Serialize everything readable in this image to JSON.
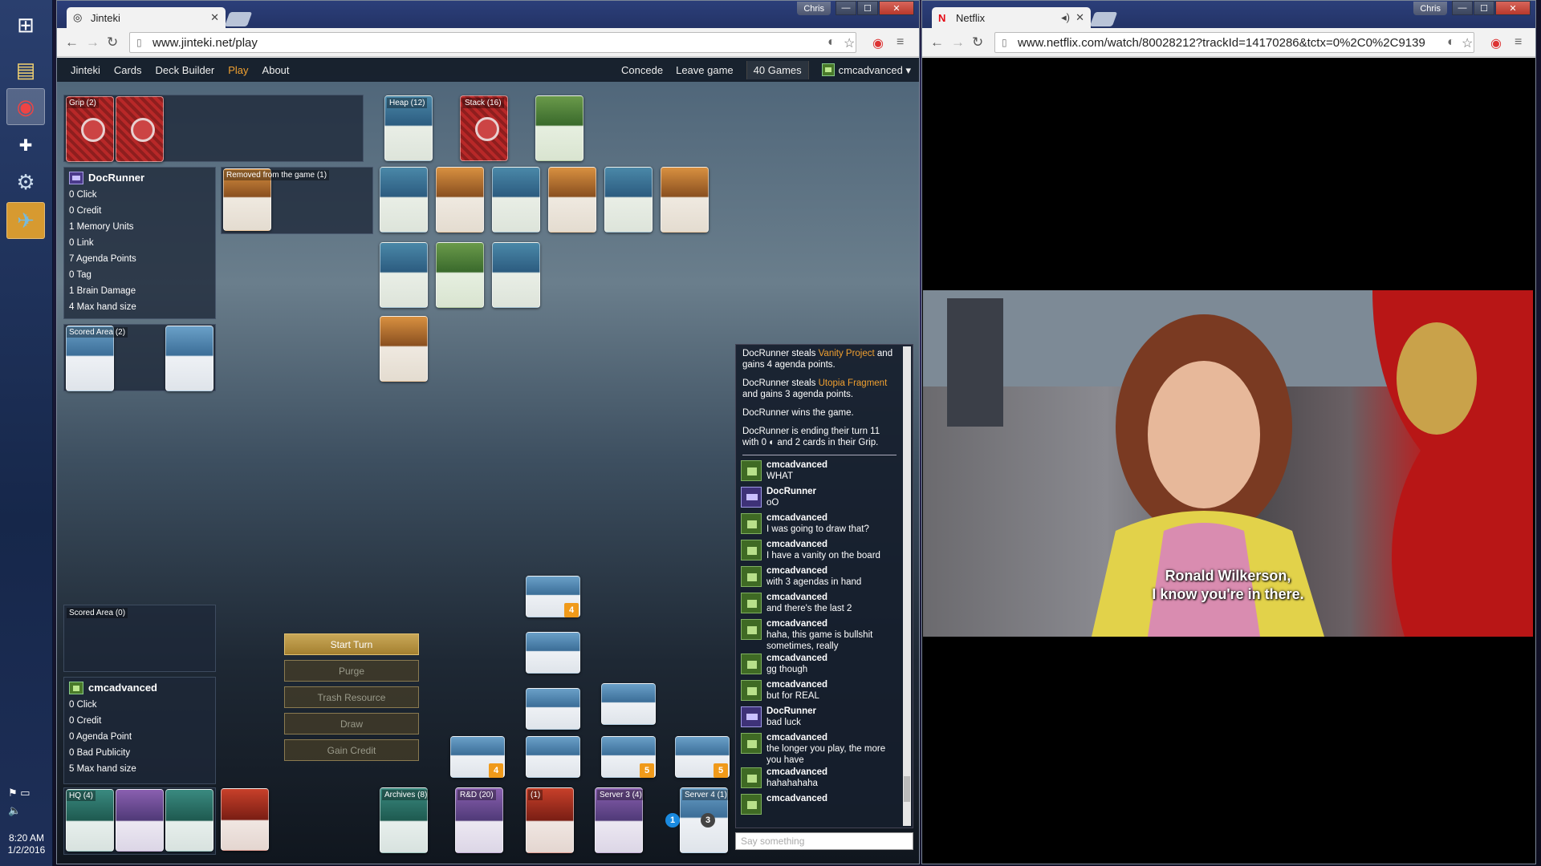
{
  "taskbar": {
    "clock_time": "8:20 AM",
    "clock_date": "1/2/2016"
  },
  "jinteki_window": {
    "profile": "Chris",
    "tab_title": "Jinteki",
    "url": "www.jinteki.net/play",
    "nav": {
      "items": [
        "Jinteki",
        "Cards",
        "Deck Builder",
        "Play",
        "About"
      ],
      "active": "Play",
      "concede": "Concede",
      "leave": "Leave game",
      "games": "40 Games",
      "user": "cmcadvanced"
    }
  },
  "netflix_window": {
    "profile": "Chris",
    "tab_title": "Netflix",
    "url": "www.netflix.com/watch/80028212?trackId=14170286&tctx=0%2C0%2C9139",
    "subtitle_line1": "Ronald Wilkerson,",
    "subtitle_line2": "I know you're in there."
  },
  "runner_board": {
    "grip_label": "Grip (2)",
    "heap_label": "Heap (12)",
    "stack_label": "Stack (16)",
    "removed_label": "Removed from the game (1)",
    "scored_label": "Scored Area (2)",
    "player": {
      "name": "DocRunner",
      "stats": [
        "0 Click",
        "0 Credit",
        "1 Memory Units",
        "0 Link",
        "7 Agenda Points",
        "0 Tag",
        "1 Brain Damage",
        "4 Max hand size"
      ]
    }
  },
  "corp_board": {
    "scored_label": "Scored Area (0)",
    "hq_label": "HQ (4)",
    "archives_label": "Archives (8)",
    "rd_label": "R&D (20)",
    "server_label": "(1)",
    "server3_label": "Server 3 (4)",
    "server4_label": "Server 4 (1)",
    "counters": [
      "4",
      "4",
      "5",
      "5",
      "1",
      "3"
    ],
    "player": {
      "name": "cmcadvanced",
      "stats": [
        "0 Click",
        "0 Credit",
        "0 Agenda Point",
        "0 Bad Publicity",
        "5 Max hand size"
      ]
    },
    "actions": {
      "start_turn": "Start Turn",
      "purge": "Purge",
      "trash_resource": "Trash Resource",
      "draw": "Draw",
      "gain_credit": "Gain Credit"
    }
  },
  "log": {
    "system": [
      {
        "pre": "DocRunner steals ",
        "card": "Vanity Project",
        "post": " and gains 4 agenda points."
      },
      {
        "pre": "DocRunner steals ",
        "card": "Utopia Fragment",
        "post": " and gains 3 agenda points."
      },
      {
        "pre": "DocRunner wins the game.",
        "card": "",
        "post": ""
      },
      {
        "pre": "DocRunner is ending their turn 11 with 0 ◐ and 2 cards in their Grip.",
        "card": "",
        "post": ""
      }
    ],
    "chat": [
      {
        "user": "cmcadvanced",
        "side": "corp",
        "text": "WHAT"
      },
      {
        "user": "DocRunner",
        "side": "runner",
        "text": "oO"
      },
      {
        "user": "cmcadvanced",
        "side": "corp",
        "text": "I was going to draw that?"
      },
      {
        "user": "cmcadvanced",
        "side": "corp",
        "text": "I have a vanity on the board"
      },
      {
        "user": "cmcadvanced",
        "side": "corp",
        "text": "with 3 agendas in hand"
      },
      {
        "user": "cmcadvanced",
        "side": "corp",
        "text": "and there's the last 2"
      },
      {
        "user": "cmcadvanced",
        "side": "corp",
        "text": "haha, this game is bullshit sometimes, really"
      },
      {
        "user": "cmcadvanced",
        "side": "corp",
        "text": "gg though"
      },
      {
        "user": "cmcadvanced",
        "side": "corp",
        "text": "but for REAL"
      },
      {
        "user": "DocRunner",
        "side": "runner",
        "text": "bad luck"
      },
      {
        "user": "cmcadvanced",
        "side": "corp",
        "text": "the longer you play, the more you have"
      },
      {
        "user": "cmcadvanced",
        "side": "corp",
        "text": "hahahahaha"
      },
      {
        "user": "cmcadvanced",
        "side": "corp",
        "text": ""
      }
    ],
    "input_placeholder": "Say something"
  }
}
